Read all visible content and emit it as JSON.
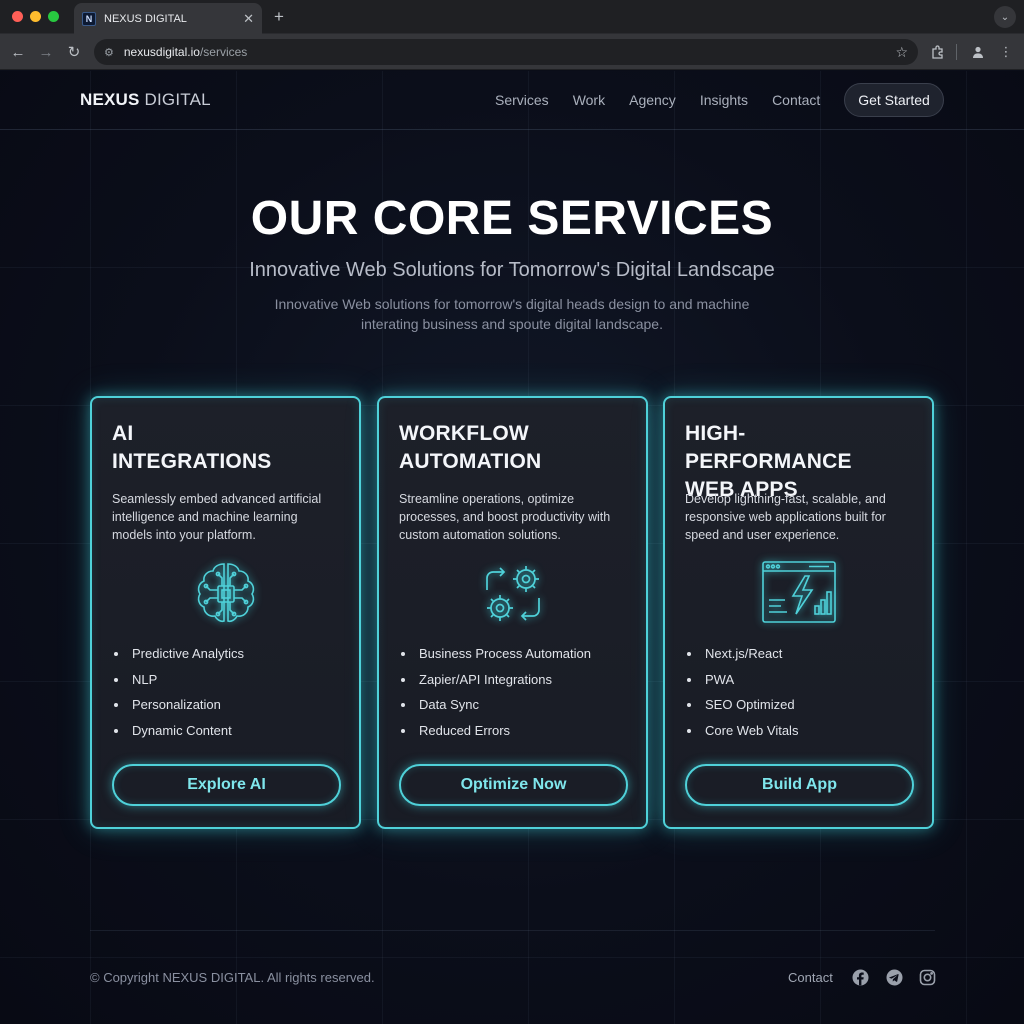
{
  "browser": {
    "tab_title": "NEXUS DIGITAL",
    "favicon_letter": "N",
    "url_domain": "nexusdigital.io",
    "url_path": "/services"
  },
  "header": {
    "logo_part1": "NEXUS",
    "logo_part2": "DIGITAL",
    "nav": [
      "Services",
      "Work",
      "Agency",
      "Insights",
      "Contact"
    ],
    "cta": "Get Started"
  },
  "hero": {
    "title": "OUR CORE SERVICES",
    "subtitle": "Innovative Web Solutions for Tomorrow's Digital Landscape",
    "description": "Innovative Web solutions for tomorrow's digital heads design to and machine interating business and spoute digital landscape."
  },
  "cards": [
    {
      "title_line1": "AI",
      "title_line2": "INTEGRATIONS",
      "description": "Seamlessly embed advanced artificial intelligence and machine learning models into your platform.",
      "icon": "brain-chip-icon",
      "features": [
        "Predictive Analytics",
        "NLP",
        "Personalization",
        "Dynamic Content"
      ],
      "button": "Explore AI"
    },
    {
      "title_line1": "WORKFLOW",
      "title_line2": "AUTOMATION",
      "description": "Streamline operations, optimize processes, and boost productivity with custom automation solutions.",
      "icon": "gears-cycle-icon",
      "features": [
        "Business Process Automation",
        "Zapier/API Integrations",
        "Data Sync",
        "Reduced Errors"
      ],
      "button": "Optimize Now"
    },
    {
      "title_line1": "HIGH-PERFORMANCE",
      "title_line2": "WEB APPS",
      "description": "Develop lightning-fast, scalable, and responsive web applications built for speed and user experience.",
      "icon": "browser-lightning-icon",
      "features": [
        "Next.js/React",
        "PWA",
        "SEO Optimized",
        "Core Web Vitals"
      ],
      "button": "Build App"
    }
  ],
  "footer": {
    "copyright": "© Copyright NEXUS DIGITAL. All rights reserved.",
    "contact": "Contact",
    "social": [
      "facebook-icon",
      "telegram-icon",
      "instagram-icon"
    ]
  },
  "colors": {
    "accent": "#4fd1d9",
    "background": "#0a0d18",
    "card": "#1d2029"
  }
}
